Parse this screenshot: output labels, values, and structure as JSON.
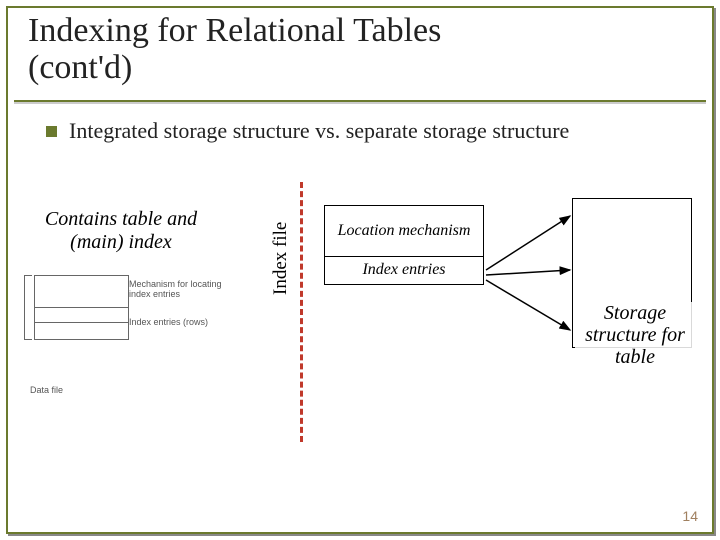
{
  "title_line1": "Indexing for Relational Tables",
  "title_line2": "(cont'd)",
  "bullet_text": "Integrated storage structure vs. separate storage structure",
  "left_caption": "Contains table and (main) index",
  "vertical_label": "Index file",
  "index_box": {
    "row1": "Location mechanism",
    "row2": "Index entries"
  },
  "table_caption": "Storage structure for table",
  "mini": {
    "lbl_mech": "Mechanism for locating index entries",
    "lbl_rows": "Index entries (rows)",
    "caption": "Data file"
  },
  "page_number": "14"
}
